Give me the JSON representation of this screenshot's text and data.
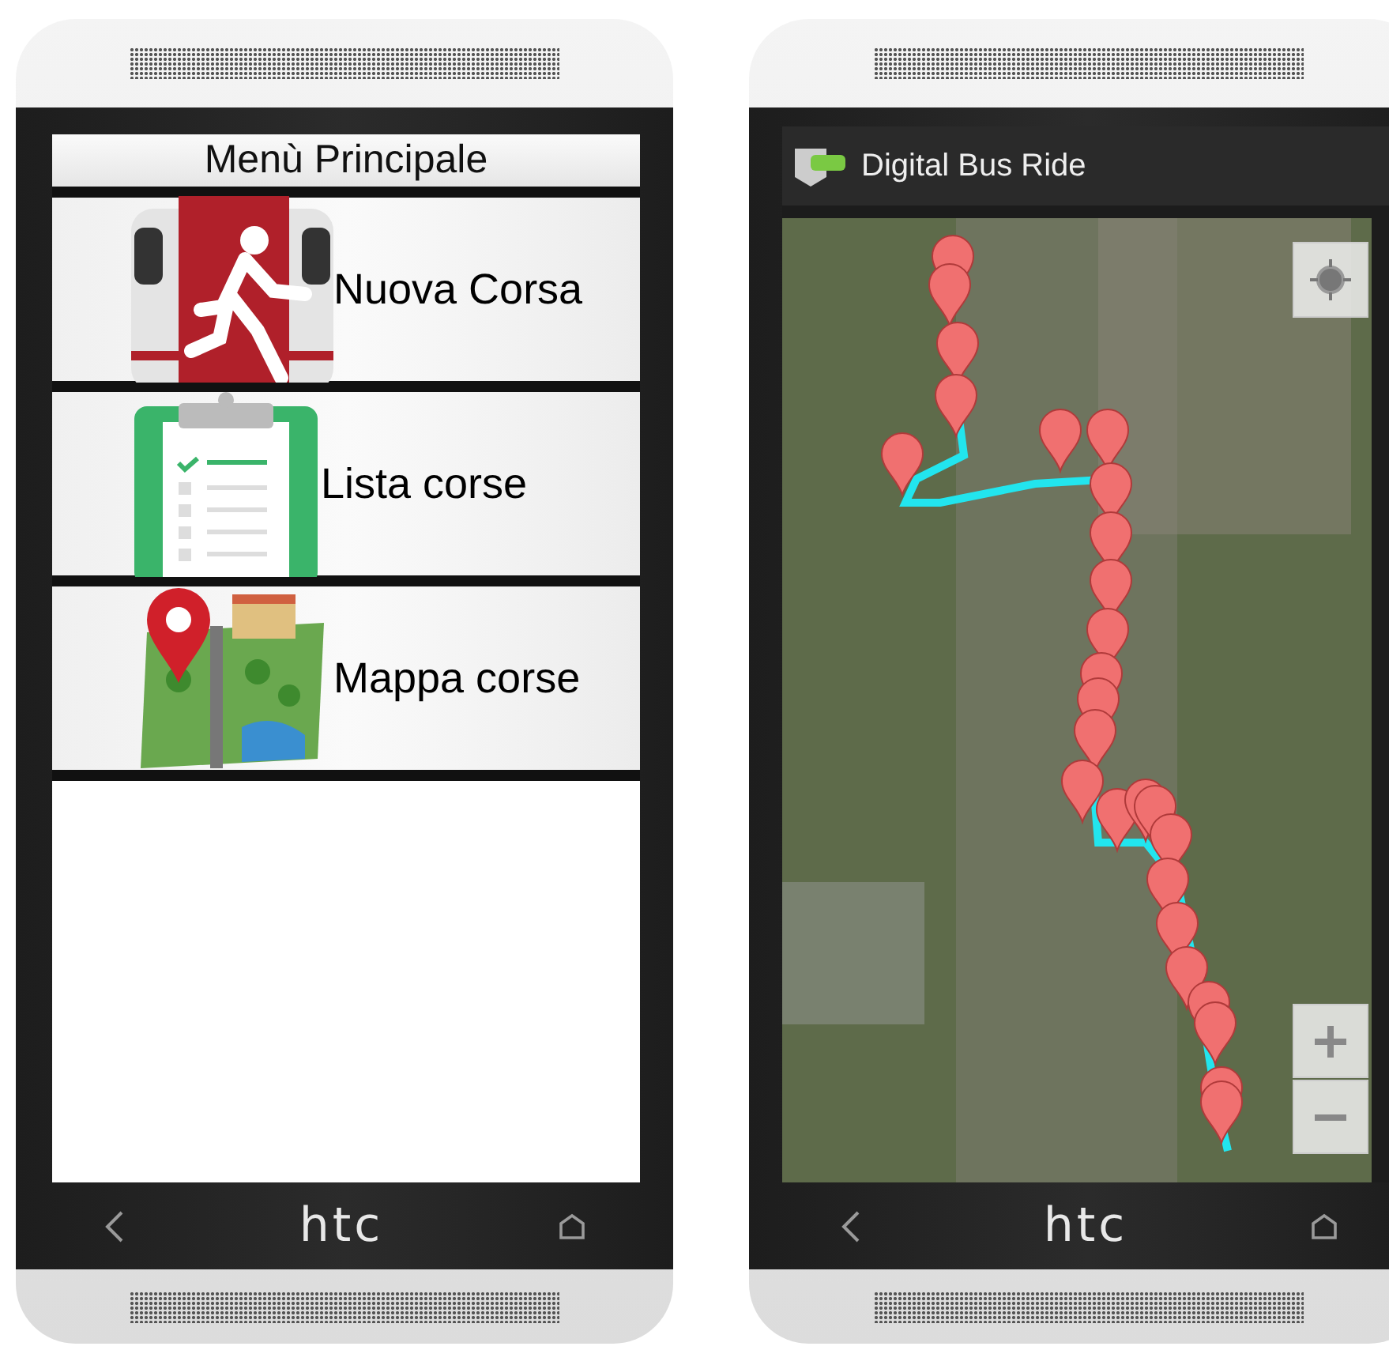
{
  "phones": [
    {
      "kind": "menu",
      "brand": "htc",
      "screen": {
        "title": "Menù Principale",
        "items": [
          {
            "label": "Nuova Corsa"
          },
          {
            "label": "Lista corse"
          },
          {
            "label": "Mappa corse"
          }
        ]
      }
    },
    {
      "kind": "map",
      "brand": "htc",
      "screen": {
        "title": "Digital Bus Ride"
      }
    }
  ]
}
